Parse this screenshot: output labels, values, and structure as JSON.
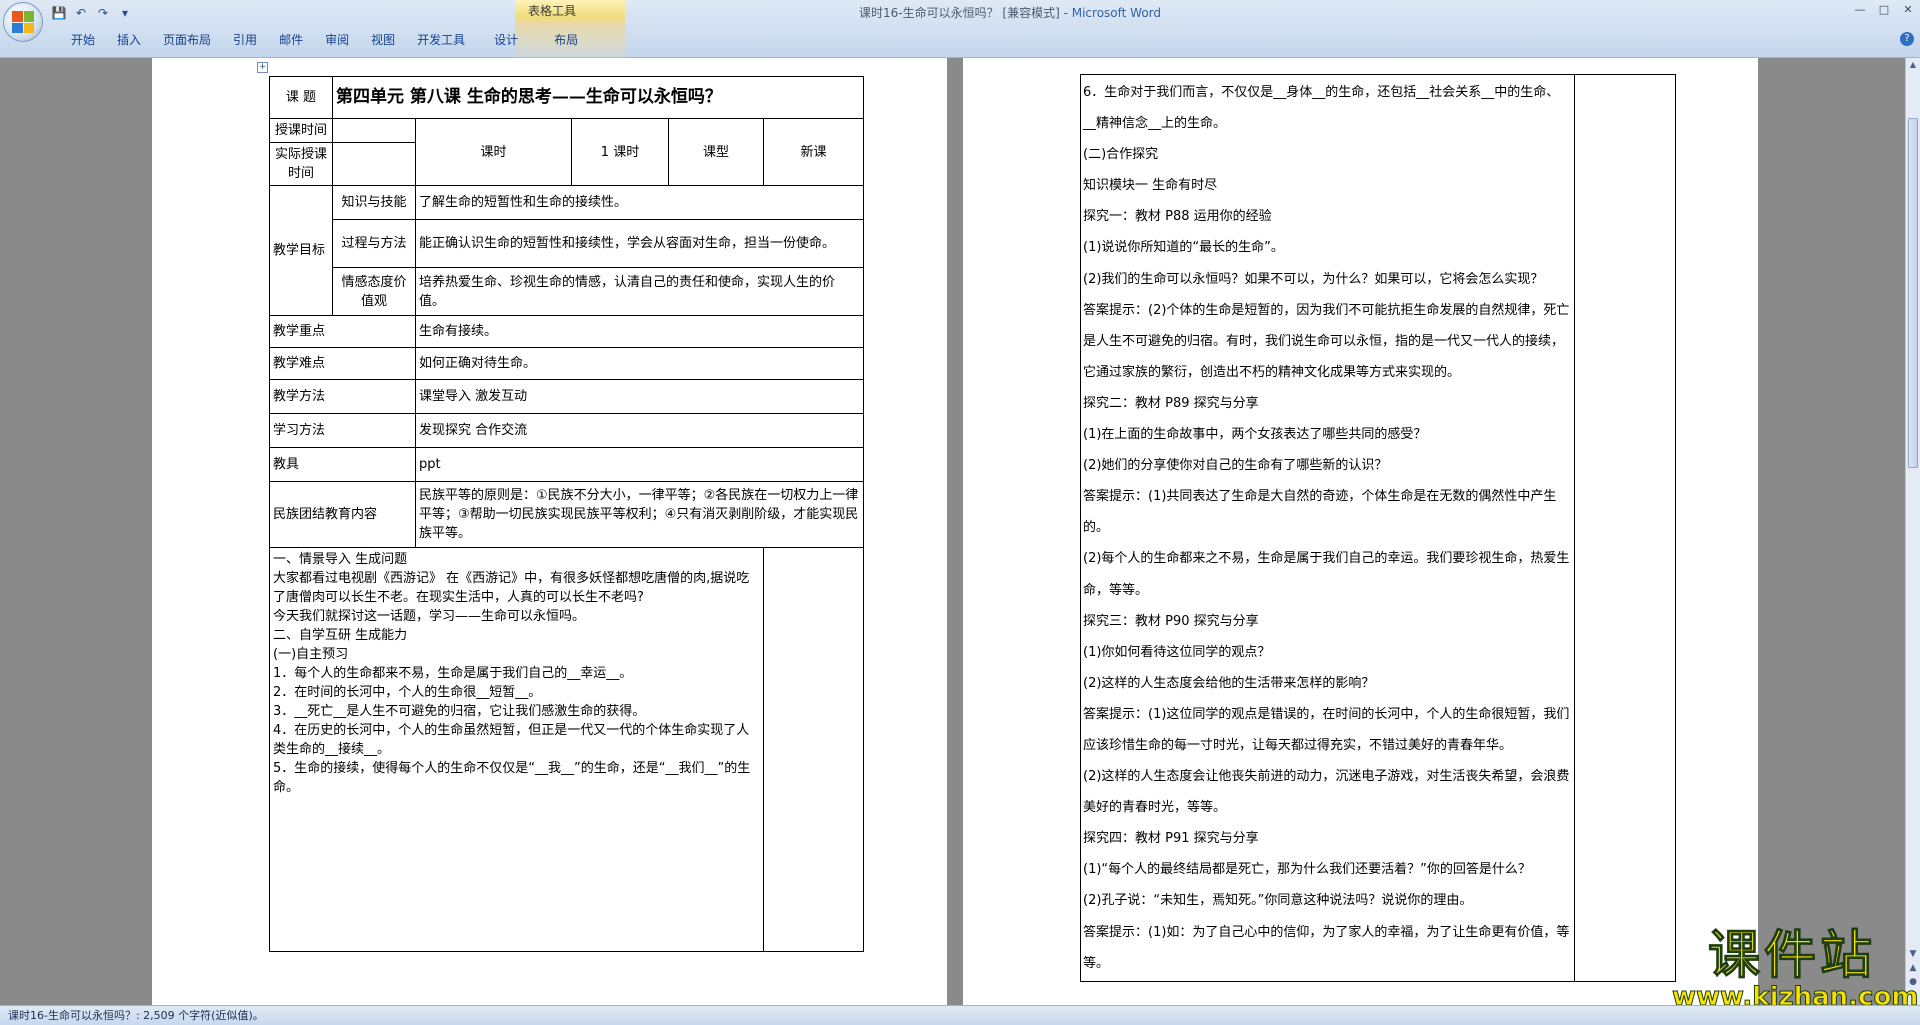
{
  "window": {
    "title": "课时16-生命可以永恒吗？ [兼容模式]",
    "app_name": "Microsoft Word",
    "table_tools_label": "表格工具"
  },
  "ribbon": {
    "tabs": [
      "开始",
      "插入",
      "页面布局",
      "引用",
      "邮件",
      "审阅",
      "视图",
      "开发工具"
    ],
    "context_tabs": [
      "设计",
      "布局"
    ],
    "help_label": "?"
  },
  "status": {
    "text": "课时16-生命可以永恒吗？: 2,509 个字符(近似值)。"
  },
  "page1": {
    "title_label": "课  题",
    "title": "第四单元   第八课   生命的思考——生命可以永恒吗？",
    "schedule_label": "授课时间",
    "actual_label": "实际授课时间",
    "hours_label": "课时",
    "hours_value": "1 课时",
    "type_label": "课型",
    "type_value": "新课",
    "goals_label": "教学目标",
    "goals": [
      {
        "name": "知识与技能",
        "text": "了解生命的短暂性和生命的接续性。"
      },
      {
        "name": "过程与方法",
        "text": "能正确认识生命的短暂性和接续性，学会从容面对生命，担当一份使命。"
      },
      {
        "name": "情感态度价值观",
        "text": "培养热爱生命、珍视生命的情感，认清自己的责任和使命，实现人生的价值。"
      }
    ],
    "rows": [
      {
        "label": "教学重点",
        "text": "生命有接续。"
      },
      {
        "label": "教学难点",
        "text": "如何正确对待生命。"
      },
      {
        "label": "教学方法",
        "text": "课堂导入   激发互动"
      },
      {
        "label": "学习方法",
        "text": "发现探究   合作交流"
      },
      {
        "label": "教具",
        "text": "ppt"
      },
      {
        "label": "民族团结教育内容",
        "text": "民族平等的原则是：①民族不分大小，一律平等；②各民族在一切权力上一律平等；③帮助一切民族实现民族平等权利；④只有消灭剥削阶级，才能实现民族平等。"
      }
    ],
    "lesson": [
      "一、情景导入   生成问题",
      "大家都看过电视剧《西游记》 在《西游记》中，有很多妖怪都想吃唐僧的肉,据说吃了唐僧肉可以长生不老。在现实生活中，人真的可以长生不老吗?",
      "今天我们就探讨这一话题，学习——生命可以永恒吗。",
      "二、自学互研   生成能力",
      "(一)自主预习",
      "1．每个人的生命都来不易，生命是属于我们自己的__幸运__。",
      "2．在时间的长河中，个人的生命很__短暂__。",
      "3．__死亡__是人生不可避免的归宿，它让我们感激生命的获得。",
      "4．在历史的长河中，个人的生命虽然短暂，但正是一代又一代的个体生命实现了人类生命的__接续__。",
      "5．生命的接续，使得每个人的生命不仅仅是“__我__”的生命，还是“__我们__”的生命。"
    ]
  },
  "page2": {
    "lines": [
      "6．生命对于我们而言，不仅仅是__身体__的生命，还包括__社会关系__中的生命、__精神信念__上的生命。",
      "(二)合作探究",
      "知识模块一   生命有时尽",
      "探究一：教材 P88 运用你的经验",
      "(1)说说你所知道的“最长的生命”。",
      "(2)我们的生命可以永恒吗？如果不可以，为什么？如果可以，它将会怎么实现？",
      "答案提示：(2)个体的生命是短暂的，因为我们不可能抗拒生命发展的自然规律，死亡是人生不可避免的归宿。有时，我们说生命可以永恒，指的是一代又一代人的接续，它通过家族的繁衍，创造出不朽的精神文化成果等方式来实现的。",
      "探究二：教材 P89 探究与分享",
      "(1)在上面的生命故事中，两个女孩表达了哪些共同的感受？",
      "(2)她们的分享使你对自己的生命有了哪些新的认识？",
      "答案提示：(1)共同表达了生命是大自然的奇迹，个体生命是在无数的偶然性中产生的。",
      "(2)每个人的生命都来之不易，生命是属于我们自己的幸运。我们要珍视生命，热爱生命，等等。",
      "探究三：教材 P90 探究与分享",
      "(1)你如何看待这位同学的观点？",
      "(2)这样的人生态度会给他的生活带来怎样的影响？",
      "答案提示：(1)这位同学的观点是错误的，在时间的长河中，个人的生命很短暂，我们应该珍惜生命的每一寸时光，让每天都过得充实，不错过美好的青春年华。",
      "(2)这样的人生态度会让他丧失前进的动力，沉迷电子游戏，对生活丧失希望，会浪费美好的青春时光，等等。",
      "探究四：教材 P91 探究与分享",
      "(1)“每个人的最终结局都是死亡，那为什么我们还要活着？”你的回答是什么？",
      "(2)孔子说：“未知生，焉知死。”你同意这种说法吗？说说你的理由。",
      "答案提示：(1)如：为了自己心中的信仰，为了家人的幸福，为了让生命更有价值，等等。"
    ]
  },
  "watermark": {
    "cn": "课件站",
    "url": "www.kjzhan.com"
  },
  "colors": {
    "ribbon": "#c4d6ec",
    "tab_text": "#15428b",
    "context_tab": "#f2dc7a",
    "watermark": "#f6e200"
  }
}
